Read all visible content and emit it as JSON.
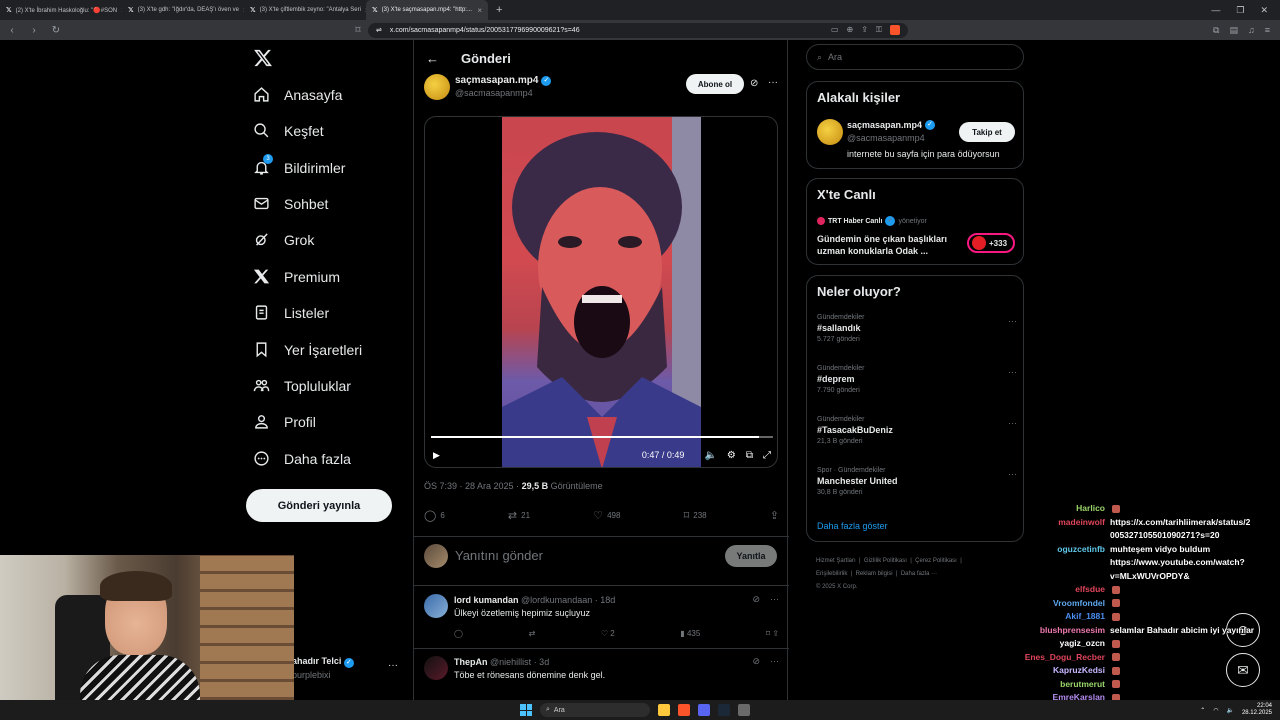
{
  "browser": {
    "tabs": [
      {
        "label": "(2) X'te İbrahim Haskoloğlu: \"🔴#SON"
      },
      {
        "label": "(3) X'te gdh: \"Iğdır'da, DEAŞ'ı öven ve"
      },
      {
        "label": "(3) X'te çiftlembik zeyno: \"Antalya Seri"
      },
      {
        "label": "(3) X'te saçmasapan.mp4: \"http:..."
      }
    ],
    "url": "x.com/sacmasapanmp4/status/2005317796990009621?s=46"
  },
  "nav": {
    "items": [
      {
        "label": "Anasayfa",
        "icon": "home-icon"
      },
      {
        "label": "Keşfet",
        "icon": "search-icon"
      },
      {
        "label": "Bildirimler",
        "icon": "bell-icon",
        "badge": "3"
      },
      {
        "label": "Sohbet",
        "icon": "mail-icon"
      },
      {
        "label": "Grok",
        "icon": "grok-icon"
      },
      {
        "label": "Premium",
        "icon": "x-icon"
      },
      {
        "label": "Listeler",
        "icon": "list-icon"
      },
      {
        "label": "Yer İşaretleri",
        "icon": "bookmark-icon"
      },
      {
        "label": "Topluluklar",
        "icon": "communities-icon"
      },
      {
        "label": "Profil",
        "icon": "profile-icon"
      },
      {
        "label": "Daha fazla",
        "icon": "more-circle-icon"
      }
    ],
    "post_button": "Gönderi yayınla",
    "me": {
      "name": "ahadır Telci",
      "handle": "purplebixi"
    }
  },
  "post": {
    "header_title": "Gönderi",
    "author_name": "saçmasapan.mp4",
    "author_handle": "@sacmasapanmp4",
    "subscribe_label": "Abone ol",
    "video": {
      "time": "0:47 / 0:49",
      "progress": 0.96
    },
    "timestamp": "ÖS 7:39 · 28 Ara 2025 · ",
    "views": "29,5 B",
    "views_label": " Görüntüleme",
    "stats": {
      "replies": "6",
      "reposts": "21",
      "likes": "498",
      "bookmarks": "238"
    },
    "reply_placeholder": "Yanıtını gönder",
    "reply_button": "Yanıtla"
  },
  "comments": [
    {
      "name": "lord kumandan",
      "handle": "@lordkumandaan",
      "time": "· 18d",
      "text": "Ülkeyi özetlemiş hepimiz suçluyuz",
      "likes": "2",
      "views": "435"
    },
    {
      "name": "ThepAn",
      "handle": "@niehillist",
      "time": "· 3d",
      "text": "Töbe et rönesans dönemine denk gel.",
      "likes": "",
      "views": ""
    }
  ],
  "sidebar": {
    "search_placeholder": "Ara",
    "related_title": "Alakalı kişiler",
    "related": {
      "name": "saçmasapan.mp4",
      "handle": "@sacmasapanmp4",
      "bio": "internete bu sayfa için para ödüyorsun",
      "follow_label": "Takip et"
    },
    "live_title": "X'te Canlı",
    "live": {
      "source": "TRT Haber Canlı",
      "status": "yönetiyor",
      "text": "Gündemin öne çıkan başlıkları uzman konuklarla Odak ...",
      "count": "+333"
    },
    "trends_title": "Neler oluyor?",
    "trends": [
      {
        "context": "Gündemdekiler",
        "name": "#sallandık",
        "count": "5.727 gönderi"
      },
      {
        "context": "Gündemdekiler",
        "name": "#deprem",
        "count": "7.790 gönderi"
      },
      {
        "context": "Gündemdekiler",
        "name": "#TasacakBuDeniz",
        "count": "21,3 B gönderi"
      },
      {
        "context": "Spor · Gündemdekiler",
        "name": "Manchester United",
        "count": "30,8 B gönderi"
      }
    ],
    "show_more": "Daha fazla göster",
    "footer": [
      "Hizmet Şartları",
      "Gizlilik Politikası",
      "Çerez Politikası",
      "Erişilebilirlik",
      "Reklam bilgisi",
      "Daha fazla ···",
      "© 2025 X Corp."
    ]
  },
  "chat": [
    {
      "user": "Harlico",
      "color": "#9ad66a",
      "msg": ""
    },
    {
      "user": "madeinwolf",
      "color": "#e0455a",
      "msg": "https://x.com/tarihliimerak/status/2"
    },
    {
      "user": "",
      "color": "#fff",
      "msg": "005327105501090271?s=20"
    },
    {
      "user": "oguzcetinfb",
      "color": "#5fc8e8",
      "msg": "muhteşem vidyo buldum"
    },
    {
      "user": "",
      "color": "#fff",
      "msg": "https://www.youtube.com/watch?"
    },
    {
      "user": "",
      "color": "#fff",
      "msg": "v=MLxWUVrOPDY&"
    },
    {
      "user": "elfsdue",
      "color": "#e0455a",
      "msg": ""
    },
    {
      "user": "Vroomfondel",
      "color": "#5fa8f0",
      "msg": ""
    },
    {
      "user": "Akif_1881",
      "color": "#4a8ef0",
      "msg": ""
    },
    {
      "user": "blushprensesim",
      "color": "#f07ab0",
      "msg": "selamlar Bahadır abicim iyi yayınlar"
    },
    {
      "user": "yagiz_ozcn",
      "color": "#ffffff",
      "msg": ""
    },
    {
      "user": "Enes_Dogu_Recber",
      "color": "#e0455a",
      "msg": ""
    },
    {
      "user": "KapruzKedsi",
      "color": "#c8b6ff",
      "msg": ""
    },
    {
      "user": "berutmerut",
      "color": "#9ad66a",
      "msg": ""
    },
    {
      "user": "EmreKarslan",
      "color": "#b48cf0",
      "msg": ""
    }
  ],
  "taskbar": {
    "search": "Ara",
    "time": "22:04",
    "date": "28.12.2025"
  }
}
